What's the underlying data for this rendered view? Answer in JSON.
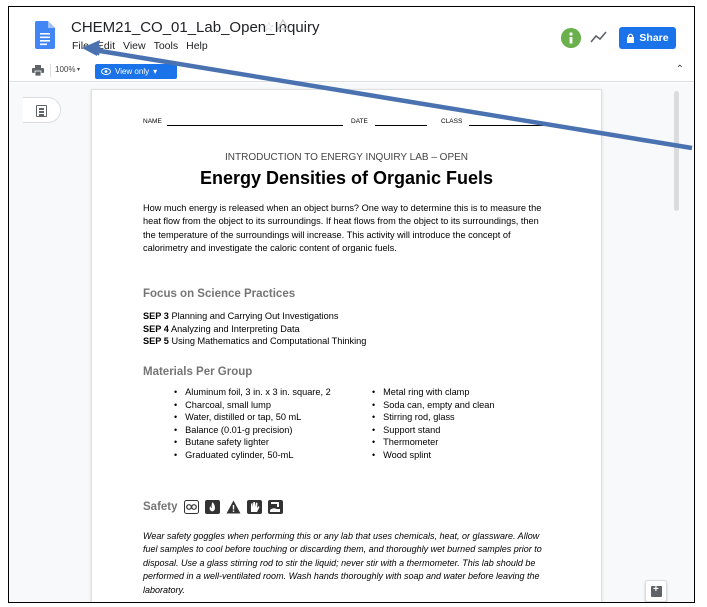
{
  "app": {
    "title": "CHEM21_CO_01_Lab_Open_Inquiry",
    "menu": [
      "File",
      "Edit",
      "View",
      "Tools",
      "Help"
    ],
    "share_label": "Share",
    "avatar_initial": "",
    "accent_color": "#1a73e8"
  },
  "toolbar": {
    "zoom": "100%",
    "mode_label": "View only",
    "mode_arrow": "▾",
    "zoom_arrow": "▾",
    "collapse": "⌃"
  },
  "document": {
    "fields": {
      "name": "NAME",
      "date": "DATE",
      "class": "CLASS"
    },
    "subtitle": "INTRODUCTION TO ENERGY INQUIRY LAB – OPEN",
    "title": "Energy Densities of Organic Fuels",
    "intro": "How much energy is released when an object burns? One way to determine this is to measure the heat flow from the object to its surroundings. If heat flows from the object to its surroundings, then the temperature of the surroundings will increase. This activity will introduce the concept of calorimetry and investigate the caloric content of organic fuels.",
    "focus_heading": "Focus on Science Practices",
    "practices": [
      {
        "code": "SEP 3",
        "text": "Planning and Carrying Out Investigations"
      },
      {
        "code": "SEP 4",
        "text": "Analyzing and Interpreting Data"
      },
      {
        "code": "SEP 5",
        "text": "Using Mathematics and Computational Thinking"
      }
    ],
    "materials_heading": "Materials Per Group",
    "materials_left": [
      "Aluminum foil, 3 in. x 3 in. square, 2",
      "Charcoal, small lump",
      "Water, distilled or tap, 50 mL",
      "Balance (0.01-g precision)",
      "Butane safety lighter",
      "Graduated cylinder, 50-mL"
    ],
    "materials_right": [
      "Metal ring with clamp",
      "Soda can, empty and clean",
      "Stirring rod, glass",
      "Support stand",
      "Thermometer",
      "Wood splint"
    ],
    "safety_heading": "Safety",
    "safety_icons": [
      "goggles-icon",
      "flame-icon",
      "warning-icon",
      "glove-icon",
      "wash-hands-icon"
    ],
    "safety_text": "Wear safety goggles when performing this or any lab that uses chemicals, heat, or glassware. Allow fuel samples to cool before touching or discarding them, and thoroughly wet burned samples prior to disposal. Use a glass stirring rod to stir the liquid; never stir with a thermometer. This lab should be performed in a well-ventilated room. Wash hands thoroughly with soap and water before leaving the laboratory."
  },
  "annotation": {
    "arrow_color": "#4a72b0"
  }
}
